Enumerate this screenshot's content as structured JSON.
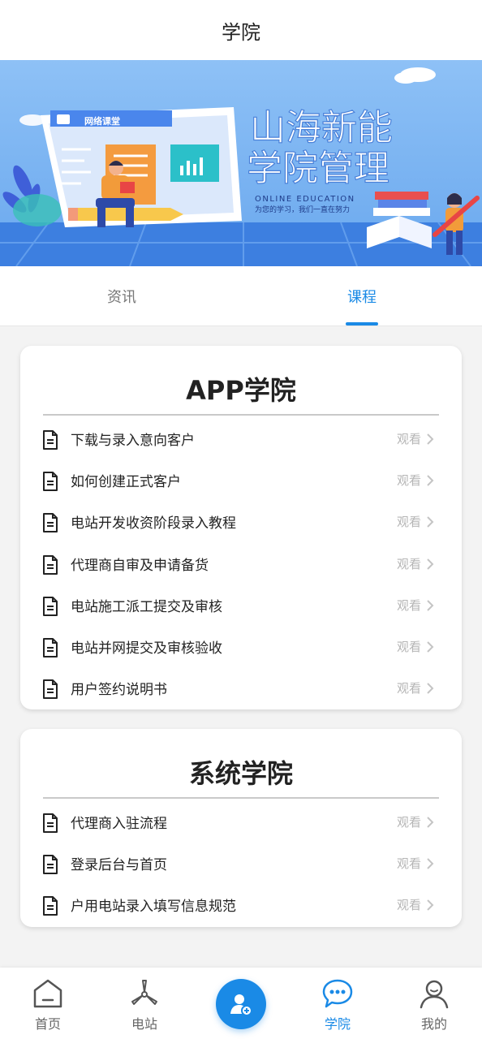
{
  "header": {
    "title": "学院"
  },
  "banner": {
    "title_line1": "山海新能",
    "title_line2": "学院管理",
    "subtitle": "ONLINE EDUCATION",
    "slogan": "为您的学习，我们一直在努力",
    "screen_label": "网络课堂"
  },
  "tabs": [
    {
      "label": "资讯",
      "active": false
    },
    {
      "label": "课程",
      "active": true
    }
  ],
  "sections": [
    {
      "title": "APP学院",
      "items": [
        {
          "label": "下载与录入意向客户",
          "action": "观看"
        },
        {
          "label": "如何创建正式客户",
          "action": "观看"
        },
        {
          "label": "电站开发收资阶段录入教程",
          "action": "观看"
        },
        {
          "label": "代理商自审及申请备货",
          "action": "观看"
        },
        {
          "label": "电站施工派工提交及审核",
          "action": "观看"
        },
        {
          "label": "电站并网提交及审核验收",
          "action": "观看"
        },
        {
          "label": "用户签约说明书",
          "action": "观看"
        }
      ]
    },
    {
      "title": "系统学院",
      "items": [
        {
          "label": "代理商入驻流程",
          "action": "观看"
        },
        {
          "label": "登录后台与首页",
          "action": "观看"
        },
        {
          "label": "户用电站录入填写信息规范",
          "action": "观看"
        }
      ]
    }
  ],
  "nav": [
    {
      "label": "首页",
      "icon": "home-icon",
      "active": false
    },
    {
      "label": "电站",
      "icon": "wind-turbine-icon",
      "active": false
    },
    {
      "label": "学院",
      "icon": "chat-bubble-icon",
      "active": true
    },
    {
      "label": "我的",
      "icon": "user-icon",
      "active": false
    }
  ],
  "center_button": {
    "icon": "add-user-icon"
  },
  "colors": {
    "accent": "#1a8ae6",
    "banner_bg": "#7ab4f2"
  }
}
